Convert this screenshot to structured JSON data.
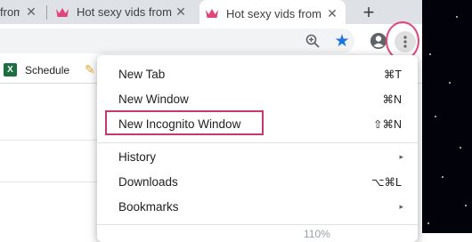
{
  "tabs": [
    {
      "title": "from",
      "active": false
    },
    {
      "title": "Hot sexy vids from",
      "active": false
    },
    {
      "title": "Hot sexy vids from",
      "active": true
    }
  ],
  "new_tab_label": "+",
  "bookmarks": [
    {
      "label": "Schedule",
      "icon": "excel-icon"
    }
  ],
  "menu": {
    "items": [
      {
        "label": "New Tab",
        "shortcut": "⌘T"
      },
      {
        "label": "New Window",
        "shortcut": "⌘N"
      },
      {
        "label": "New Incognito Window",
        "shortcut": "⇧⌘N"
      },
      {
        "label": "History",
        "shortcut": "▸"
      },
      {
        "label": "Downloads",
        "shortcut": "⌥⌘L"
      },
      {
        "label": "Bookmarks",
        "shortcut": "▸"
      }
    ],
    "partial_zoom_value": "110%"
  },
  "colors": {
    "highlight": "#c8386f",
    "accent": "#1a73e8",
    "favicon": "#e0467c"
  }
}
